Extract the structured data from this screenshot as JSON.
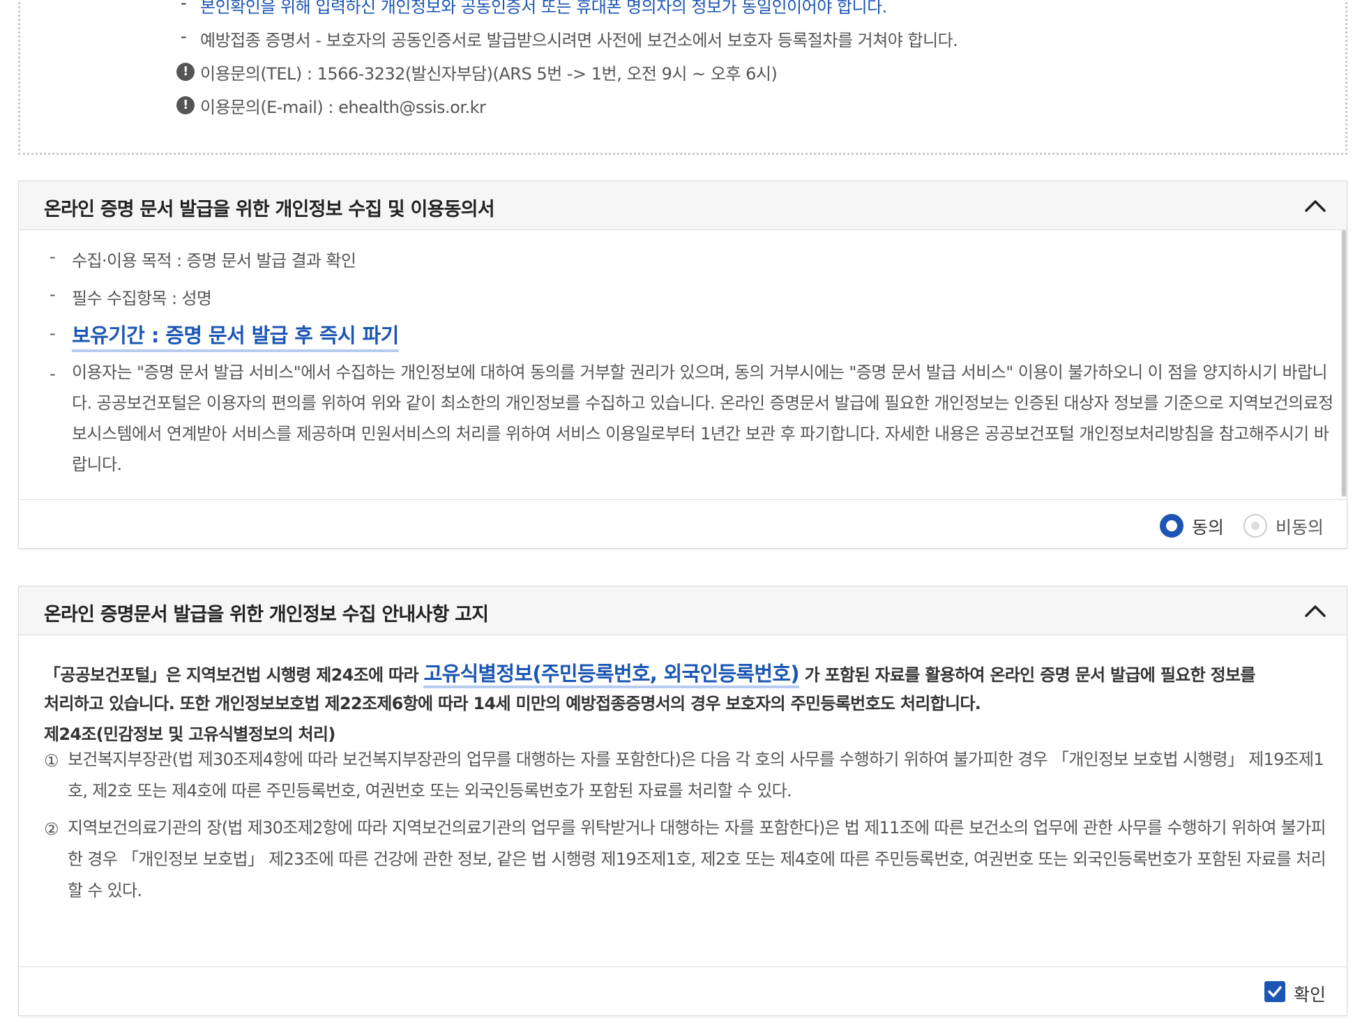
{
  "notice_box": {
    "line1": "본인확인을 위해 입력하신 개인정보와 공동인증서 또는 휴대폰 명의자의 정보가 동일인이어야 합니다.",
    "line2": "예방접종 증명서 - 보호자의 공동인증서로 발급받으시려면 사전에 보건소에서 보호자 등록절차를 거쳐야 합니다.",
    "tel": "이용문의(TEL) : 1566-3232(발신자부담)(ARS 5번 -> 1번, 오전 9시 ~ 오후 6시)",
    "email": "이용문의(E-mail) : ehealth@ssis.or.kr",
    "dash": "-",
    "info_icon_glyph": "!"
  },
  "consent_panel": {
    "title": "온라인 증명 문서 발급을 위한 개인정보 수집 및 이용동의서",
    "items": [
      "수집·이용 목적 : 증명 문서 발급 결과 확인",
      "필수 수집항목 : 성명",
      "보유기간 : 증명 문서 발급 후 즉시 파기"
    ],
    "paragraph": "이용자는 \"증명 문서 발급 서비스\"에서 수집하는 개인정보에 대하여 동의를 거부할 권리가 있으며, 동의 거부시에는 \"증명 문서 발급 서비스\" 이용이 불가하오니 이 점을 양지하시기 바랍니다. 공공보건포털은 이용자의 편의를 위하여 위와 같이 최소한의 개인정보를 수집하고 있습니다. 온라인 증명문서 발급에 필요한 개인정보는 인증된 대상자 정보를 기준으로 지역보건의료정보시스템에서 연계받아 서비스를 제공하며 민원서비스의 처리를 위하여 서비스 이용일로부터 1년간 보관 후 파기합니다. 자세한 내용은 공공보건포털 개인정보처리방침을 참고해주시기 바랍니다.",
    "agree_label": "동의",
    "disagree_label": "비동의",
    "selected": "agree"
  },
  "notice_panel": {
    "title": "온라인 증명문서 발급을 위한 개인정보 수집 안내사항 고지",
    "intro_pre": "「공공보건포털」은 지역보건법 시행령 제24조에 따라",
    "intro_highlight": "고유식별정보(주민등록번호, 외국인등록번호)",
    "intro_post": "가 포함된 자료를 활용하여 온라인 증명 문서 발급에 필요한 정보를",
    "intro_line2": "처리하고 있습니다. 또한 개인정보보호법 제22조제6항에 따라 14세 미만의 예방접종증명서의 경우 보호자의 주민등록번호도 처리합니다.",
    "article_title": "제24조(민감정보 및 고유식별정보의 처리)",
    "clauses": [
      {
        "num": "①",
        "text": "보건복지부장관(법 제30조제4항에 따라 보건복지부장관의 업무를 대행하는 자를 포함한다)은 다음 각 호의 사무를 수행하기 위하여 불가피한 경우 「개인정보 보호법 시행령」 제19조제1호, 제2호 또는 제4호에 따른 주민등록번호, 여권번호 또는 외국인등록번호가 포함된 자료를 처리할 수 있다."
      },
      {
        "num": "②",
        "text": "지역보건의료기관의 장(법 제30조제2항에 따라 지역보건의료기관의 업무를 위탁받거나 대행하는 자를 포함한다)은 법 제11조에 따른 보건소의 업무에 관한 사무를 수행하기 위하여 불가피한 경우 「개인정보 보호법」 제23조에 따른 건강에 관한 정보, 같은 법 시행령 제19조제1호, 제2호 또는 제4호에 따른 주민등록번호, 여권번호 또는 외국인등록번호가 포함된 자료를 처리할 수 있다."
      }
    ],
    "confirm_label": "확인",
    "confirm_checked": true
  },
  "colors": {
    "accent": "#1b56b4",
    "highlight_underline": "#b7cdf0",
    "header_bg": "#f6f6f6",
    "border": "#d7d7d7"
  },
  "icons": {
    "info": "exclamation-circle-icon",
    "collapse": "chevron-up-icon",
    "check": "checkmark-icon"
  }
}
